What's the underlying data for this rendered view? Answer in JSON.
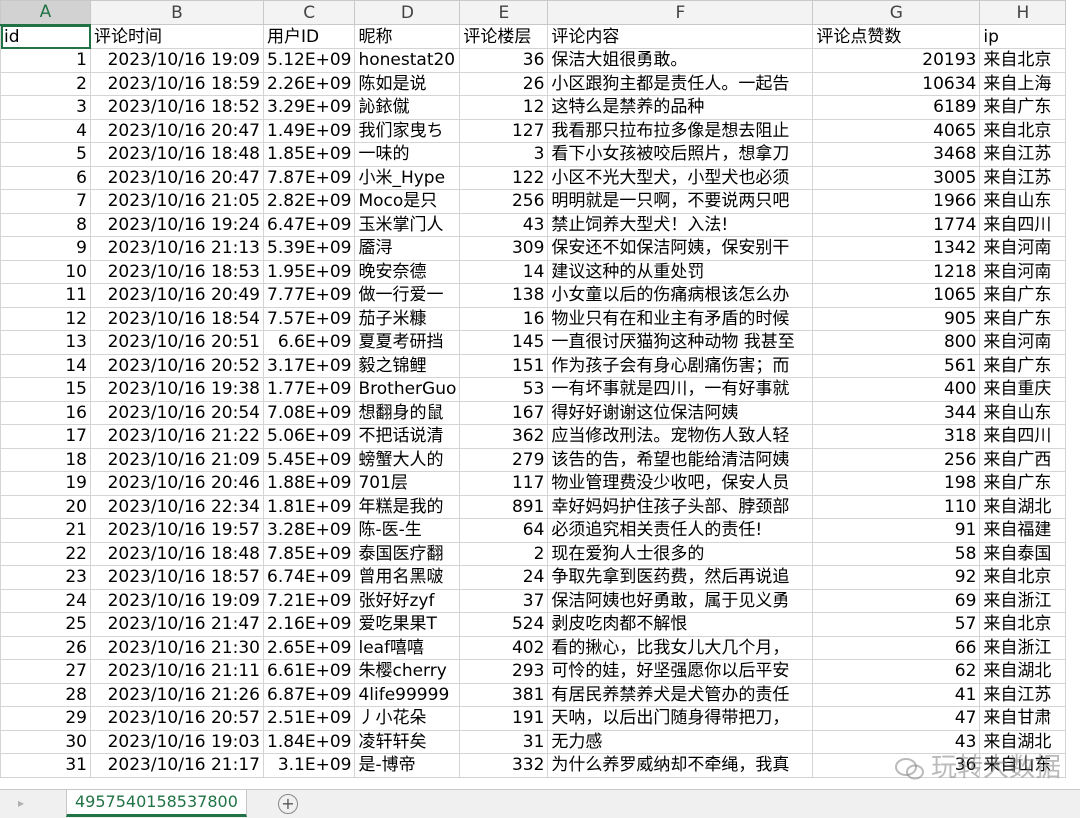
{
  "columns": [
    "A",
    "B",
    "C",
    "D",
    "E",
    "F",
    "G",
    "H"
  ],
  "selected_column": "A",
  "selected_row": "1",
  "header_row": [
    "id",
    "评论时间",
    "用户ID",
    "昵称",
    "评论楼层",
    "评论内容",
    "评论点赞数",
    "ip"
  ],
  "rows": [
    [
      "1",
      "2023/10/16 19:09",
      "5.12E+09",
      "honestat20",
      "36",
      "保洁大姐很勇敢。",
      "20193",
      "来自北京"
    ],
    [
      "2",
      "2023/10/16 18:59",
      "2.26E+09",
      "陈如是说",
      "26",
      "小区跟狗主都是责任人。一起告",
      "10634",
      "来自上海"
    ],
    [
      "3",
      "2023/10/16 18:52",
      "3.29E+09",
      "訫銥僦",
      "12",
      "这特么是禁养的品种",
      "6189",
      "来自广东"
    ],
    [
      "4",
      "2023/10/16 20:47",
      "1.49E+09",
      "我们家曳ち",
      "127",
      "我看那只拉布拉多像是想去阻止",
      "4065",
      "来自北京"
    ],
    [
      "5",
      "2023/10/16 18:48",
      "1.85E+09",
      "一味的",
      "3",
      "看下小女孩被咬后照片，想拿刀",
      "3468",
      "来自江苏"
    ],
    [
      "6",
      "2023/10/16 20:47",
      "7.87E+09",
      "小米_Hype",
      "122",
      "小区不光大型犬，小型犬也必须",
      "3005",
      "来自江苏"
    ],
    [
      "7",
      "2023/10/16 21:05",
      "2.82E+09",
      "Moco是只",
      "256",
      "明明就是一只啊，不要说两只吧",
      "1966",
      "来自山东"
    ],
    [
      "8",
      "2023/10/16 19:24",
      "6.47E+09",
      "玉米掌门人",
      "43",
      "禁止饲养大型犬！入法!",
      "1774",
      "来自四川"
    ],
    [
      "9",
      "2023/10/16 21:13",
      "5.39E+09",
      "靥浔",
      "309",
      "保安还不如保洁阿姨，保安别干",
      "1342",
      "来自河南"
    ],
    [
      "10",
      "2023/10/16 18:53",
      "1.95E+09",
      "晚安奈德",
      "14",
      "建议这种的从重处罚",
      "1218",
      "来自河南"
    ],
    [
      "11",
      "2023/10/16 20:49",
      "7.77E+09",
      "做一行爱一",
      "138",
      "小女童以后的伤痛病根该怎么办",
      "1065",
      "来自广东"
    ],
    [
      "12",
      "2023/10/16 18:54",
      "7.57E+09",
      "茄子米糠",
      "16",
      "物业只有在和业主有矛盾的时候",
      "905",
      "来自广东"
    ],
    [
      "13",
      "2023/10/16 20:51",
      "6.6E+09",
      "夏夏考研挡",
      "145",
      "一直很讨厌猫狗这种动物 我甚至",
      "800",
      "来自河南"
    ],
    [
      "14",
      "2023/10/16 20:52",
      "3.17E+09",
      "毅之锦鲤",
      "151",
      "作为孩子会有身心剧痛伤害；而",
      "561",
      "来自广东"
    ],
    [
      "15",
      "2023/10/16 19:38",
      "1.77E+09",
      "BrotherGuo",
      "53",
      "一有坏事就是四川，一有好事就",
      "400",
      "来自重庆"
    ],
    [
      "16",
      "2023/10/16 20:54",
      "7.08E+09",
      "想翻身的鼠",
      "167",
      "得好好谢谢这位保洁阿姨",
      "344",
      "来自山东"
    ],
    [
      "17",
      "2023/10/16 21:22",
      "5.06E+09",
      "不把话说清",
      "362",
      "应当修改刑法。宠物伤人致人轻",
      "318",
      "来自四川"
    ],
    [
      "18",
      "2023/10/16 21:09",
      "5.45E+09",
      "螃蟹大人的",
      "279",
      "该告的告，希望也能给清洁阿姨",
      "256",
      "来自广西"
    ],
    [
      "19",
      "2023/10/16 20:46",
      "1.88E+09",
      "701层",
      "117",
      "物业管理费没少收吧，保安人员",
      "198",
      "来自广东"
    ],
    [
      "20",
      "2023/10/16 22:34",
      "1.81E+09",
      "年糕是我的",
      "891",
      "幸好妈妈护住孩子头部、脖颈部",
      "110",
      "来自湖北"
    ],
    [
      "21",
      "2023/10/16 19:57",
      "3.28E+09",
      "陈-医-生",
      "64",
      "必须追究相关责任人的责任!",
      "91",
      "来自福建"
    ],
    [
      "22",
      "2023/10/16 18:48",
      "7.85E+09",
      "泰国医疗翻",
      "2",
      "现在爱狗人士很多的",
      "58",
      "来自泰国"
    ],
    [
      "23",
      "2023/10/16 18:57",
      "6.74E+09",
      "曾用名黑啵",
      "24",
      "争取先拿到医药费，然后再说追",
      "92",
      "来自北京"
    ],
    [
      "24",
      "2023/10/16 19:09",
      "7.21E+09",
      "张好好zyf",
      "37",
      "保洁阿姨也好勇敢，属于见义勇",
      "69",
      "来自浙江"
    ],
    [
      "25",
      "2023/10/16 21:47",
      "2.16E+09",
      "爱吃果果T",
      "524",
      "剥皮吃肉都不解恨",
      "57",
      "来自北京"
    ],
    [
      "26",
      "2023/10/16 21:30",
      "2.65E+09",
      "leaf嘻嘻",
      "402",
      "看的揪心，比我女儿大几个月，",
      "66",
      "来自浙江"
    ],
    [
      "27",
      "2023/10/16 21:11",
      "6.61E+09",
      "朱樱cherry",
      "293",
      "可怜的娃，好坚强愿你以后平安",
      "62",
      "来自湖北"
    ],
    [
      "28",
      "2023/10/16 21:26",
      "6.87E+09",
      "4life99999",
      "381",
      "有居民养禁养犬是犬管办的责任",
      "41",
      "来自江苏"
    ],
    [
      "29",
      "2023/10/16 20:57",
      "2.51E+09",
      "丿小花朵",
      "191",
      "天呐，以后出门随身得带把刀，",
      "47",
      "来自甘肃"
    ],
    [
      "30",
      "2023/10/16 19:03",
      "1.84E+09",
      "凌轩轩矣",
      "31",
      "无力感",
      "43",
      "来自湖北"
    ],
    [
      "31",
      "2023/10/16 21:17",
      "3.1E+09",
      "是-博帝",
      "332",
      "为什么养罗威纳却不牵绳，我真",
      "36",
      "来自山东"
    ]
  ],
  "sheet_tab": "4957540158537800",
  "add_sheet_symbol": "+",
  "watermark": "玩转大数据",
  "colors": {
    "accent": "#217346",
    "grid": "#d4d4d4",
    "header_bg": "#f3f3f3"
  }
}
